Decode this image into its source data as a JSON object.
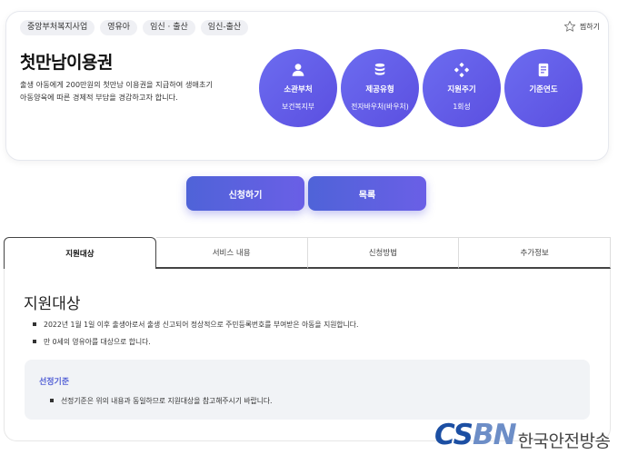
{
  "tags": [
    "중앙부처복지사업",
    "영유아",
    "임신 · 출산",
    "임신-출산"
  ],
  "bookmark": {
    "label": "찜하기",
    "icon": "star-icon"
  },
  "program": {
    "title": "첫만남이용권",
    "description": "출생 아동에게 200만원의 첫만남 이용권을 지급하여 생애초기 아동양육에 따른 경제적 부담을 경감하고자 합니다."
  },
  "info_circles": [
    {
      "label": "소관부처",
      "value": "보건복지부",
      "icon": "person-icon"
    },
    {
      "label": "제공유형",
      "value": "전자바우처(바우처)",
      "icon": "coins-icon"
    },
    {
      "label": "지원주기",
      "value": "1회성",
      "icon": "cycle-icon"
    },
    {
      "label": "기준연도",
      "value": "",
      "icon": "document-icon"
    }
  ],
  "buttons": {
    "apply": "신청하기",
    "list": "목록"
  },
  "tabs": [
    "지원대상",
    "서비스 내용",
    "신청방법",
    "추가정보"
  ],
  "section": {
    "title": "지원대상",
    "bullets": [
      "2022년 1월 1일 이후 출생아로서 출생 신고되어 정상적으로 주민등록번호를 부여받은 아동을 지원합니다.",
      "만 0세의 영유아를 대상으로 합니다."
    ],
    "criteria": {
      "title": "선정기준",
      "item": "선정기준은 위의 내용과 동일하므로 지원대상을 참고해주시기 바랍니다."
    }
  },
  "watermark": {
    "logo_prefix": "CS",
    "logo_suffix": "BN",
    "text": "한국안전방송"
  },
  "colors": {
    "accent": "#5b4fe0",
    "button": "#5a62dc",
    "criteria_title": "#5663d6"
  }
}
